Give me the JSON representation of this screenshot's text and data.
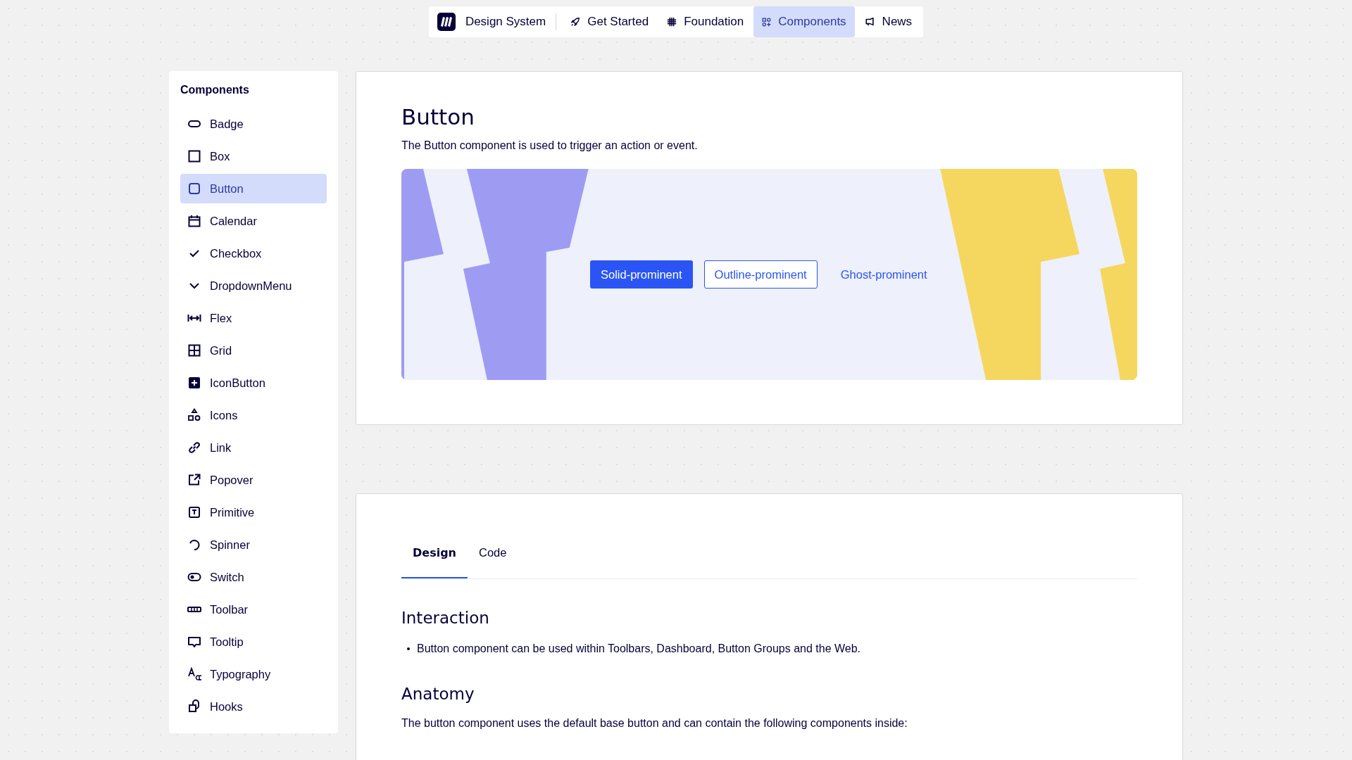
{
  "nav": {
    "brand": "Design System",
    "items": [
      {
        "label": "Get Started",
        "selected": false
      },
      {
        "label": "Foundation",
        "selected": false
      },
      {
        "label": "Components",
        "selected": true
      },
      {
        "label": "News",
        "selected": false
      }
    ]
  },
  "sidebar": {
    "title": "Components",
    "items": [
      {
        "label": "Badge",
        "selected": false
      },
      {
        "label": "Box",
        "selected": false
      },
      {
        "label": "Button",
        "selected": true
      },
      {
        "label": "Calendar",
        "selected": false
      },
      {
        "label": "Checkbox",
        "selected": false
      },
      {
        "label": "DropdownMenu",
        "selected": false
      },
      {
        "label": "Flex",
        "selected": false
      },
      {
        "label": "Grid",
        "selected": false
      },
      {
        "label": "IconButton",
        "selected": false
      },
      {
        "label": "Icons",
        "selected": false
      },
      {
        "label": "Link",
        "selected": false
      },
      {
        "label": "Popover",
        "selected": false
      },
      {
        "label": "Primitive",
        "selected": false
      },
      {
        "label": "Spinner",
        "selected": false
      },
      {
        "label": "Switch",
        "selected": false
      },
      {
        "label": "Toolbar",
        "selected": false
      },
      {
        "label": "Tooltip",
        "selected": false
      },
      {
        "label": "Typography",
        "selected": false
      },
      {
        "label": "Hooks",
        "selected": false
      }
    ]
  },
  "page": {
    "title": "Button",
    "description": "The Button component is used to trigger an action or event.",
    "demo_buttons": [
      {
        "label": "Solid-prominent",
        "kind": "solid"
      },
      {
        "label": "Outline-prominent",
        "kind": "outline"
      },
      {
        "label": "Ghost-prominent",
        "kind": "ghost"
      }
    ]
  },
  "details": {
    "tabs": [
      {
        "label": "Design",
        "selected": true
      },
      {
        "label": "Code",
        "selected": false
      }
    ],
    "sections": [
      {
        "heading": "Interaction",
        "bullets": [
          "Button component can be used within Toolbars, Dashboard, Button Groups and the Web."
        ]
      },
      {
        "heading": "Anatomy",
        "text": "The button component uses the default base button and can contain the following components inside:"
      }
    ]
  }
}
